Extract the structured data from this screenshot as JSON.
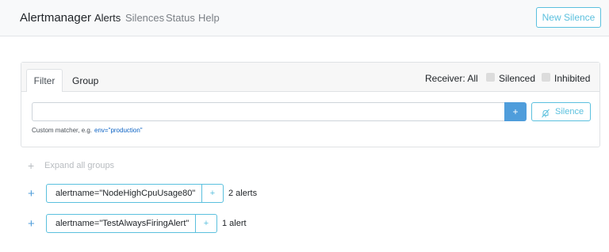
{
  "navbar": {
    "brand": "Alertmanager",
    "links": [
      "Alerts",
      "Silences",
      "Status",
      "Help"
    ],
    "new_silence": "New Silence"
  },
  "filter_card": {
    "tabs": [
      "Filter",
      "Group"
    ],
    "receiver": "Receiver: All",
    "silenced": "Silenced",
    "inhibited": "Inhibited",
    "matcher_value": "",
    "add_label": "+",
    "silence_label": "Silence",
    "hint_text": "Custom matcher, e.g.",
    "hint_example": "env=\"production\""
  },
  "expand_all": {
    "plus": "+",
    "label": "Expand all groups"
  },
  "groups": [
    {
      "plus": "+",
      "label": "alertname=\"NodeHighCpuUsage80\"",
      "add": "+",
      "count": "2 alerts"
    },
    {
      "plus": "+",
      "label": "alertname=\"TestAlwaysFiringAlert\"",
      "add": "+",
      "count": "1 alert"
    }
  ],
  "colors": {
    "accent": "#5bc0de",
    "primary": "#4f9ddb",
    "link": "#0b62c4"
  }
}
